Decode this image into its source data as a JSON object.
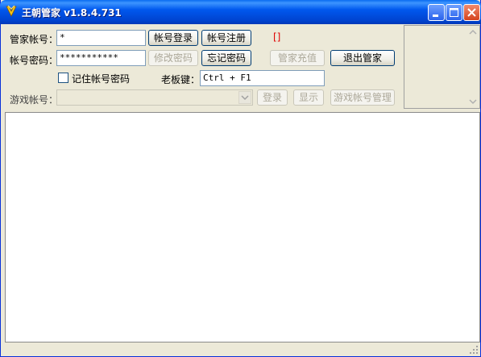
{
  "window": {
    "title": "王朝管家  v1.8.4.731",
    "icon": "shield-logo-icon"
  },
  "login": {
    "account_label": "管家帐号：",
    "account_value": "*",
    "password_label": "帐号密码：",
    "password_value": "***********",
    "remember_label": "记住帐号密码",
    "hotkey_label": "老板键：",
    "hotkey_value": "Ctrl + F1",
    "game_account_label": "游戏帐号：",
    "status_bracket": "[]"
  },
  "buttons": {
    "login": "帐号登录",
    "register": "帐号注册",
    "change_password": "修改密码",
    "forgot_password": "忘记密码",
    "recharge": "管家充值",
    "exit": "退出管家",
    "game_login": "登录",
    "show": "显示",
    "game_account_manage": "游戏帐号管理"
  },
  "colors": {
    "title_bar": "#0054e3",
    "status_red": "#e00000"
  }
}
